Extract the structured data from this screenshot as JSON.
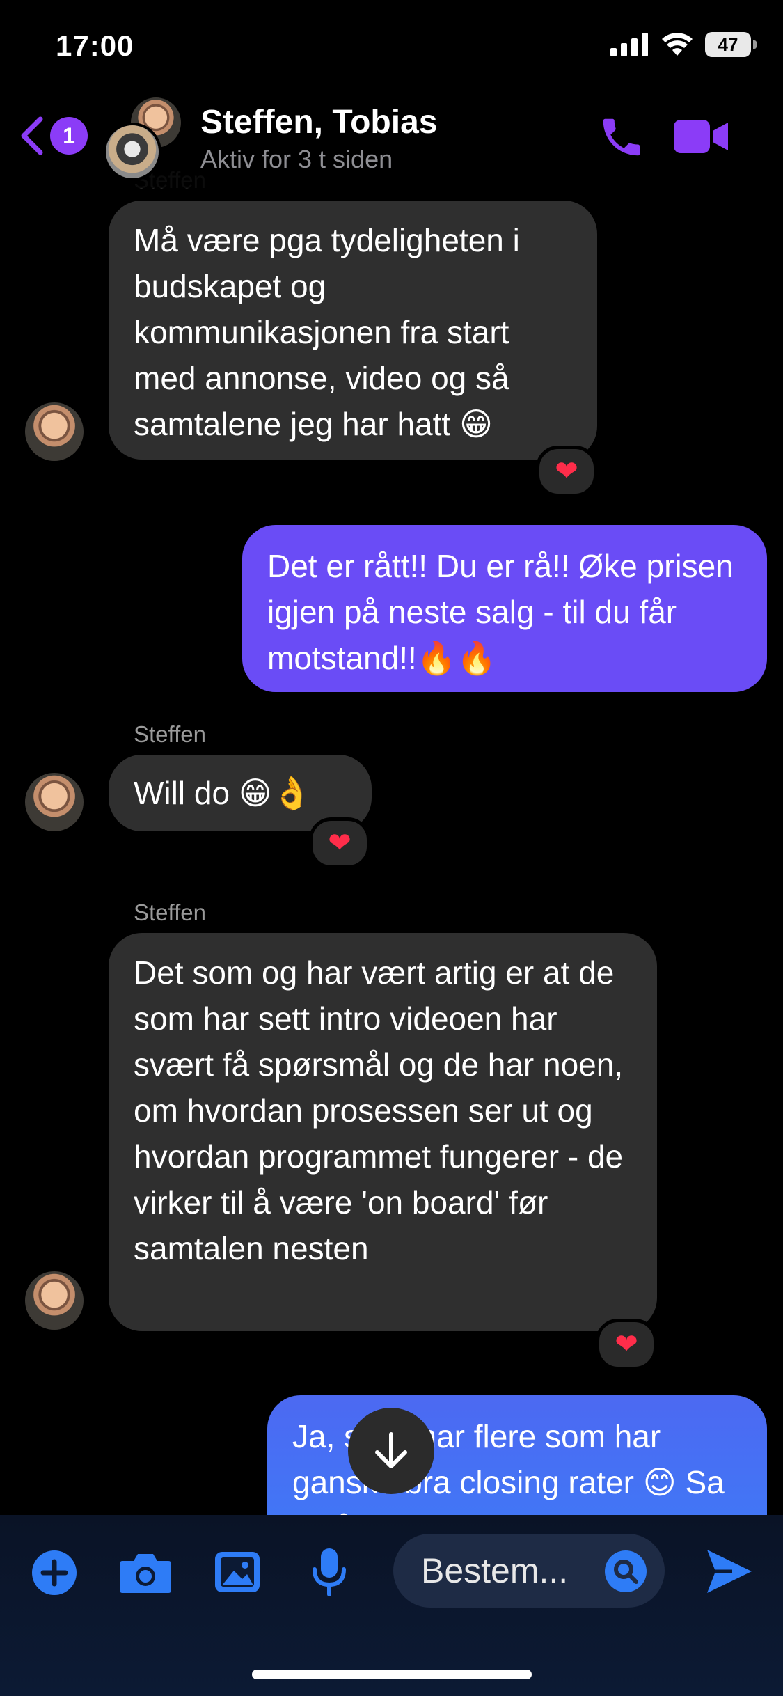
{
  "status": {
    "time": "17:00",
    "battery": "47"
  },
  "header": {
    "back_badge": "1",
    "title": "Steffen, Tobias",
    "subtitle": "Aktiv for 3 t siden"
  },
  "messages": [
    {
      "sender": "Steffen",
      "text": "Må være pga tydeligheten i budskapet og kommunikasjonen fra start med annonse, video og så samtalene jeg har hatt 😁",
      "reaction": "❤"
    },
    {
      "sender": "me",
      "text": "Det er rått!! Du er rå!! Øke prisen igjen på neste salg - til du får motstand!!🔥🔥"
    },
    {
      "sender": "Steffen",
      "text": "Will do 😁👌",
      "reaction": "❤"
    },
    {
      "sender": "Steffen",
      "text": "Det som og har vært artig er at de som har sett intro videoen har svært få spørsmål og de har noen, om hvordan prosessen ser ut og hvordan programmet fungerer - de virker til å være 'on board' før samtalen nesten",
      "reaction": "❤"
    },
    {
      "sender": "me",
      "text": "Ja, så vi har flere som har ganske bra closing rater 😊 Sa alt å kunde"
    }
  ],
  "composer": {
    "placeholder": "Bestem..."
  },
  "colors": {
    "accent": "#8b3cf7",
    "outgoing": "#6a4cf6",
    "outgoing_blue": "#3d7cf7",
    "composer_icon": "#2e7cf6"
  }
}
